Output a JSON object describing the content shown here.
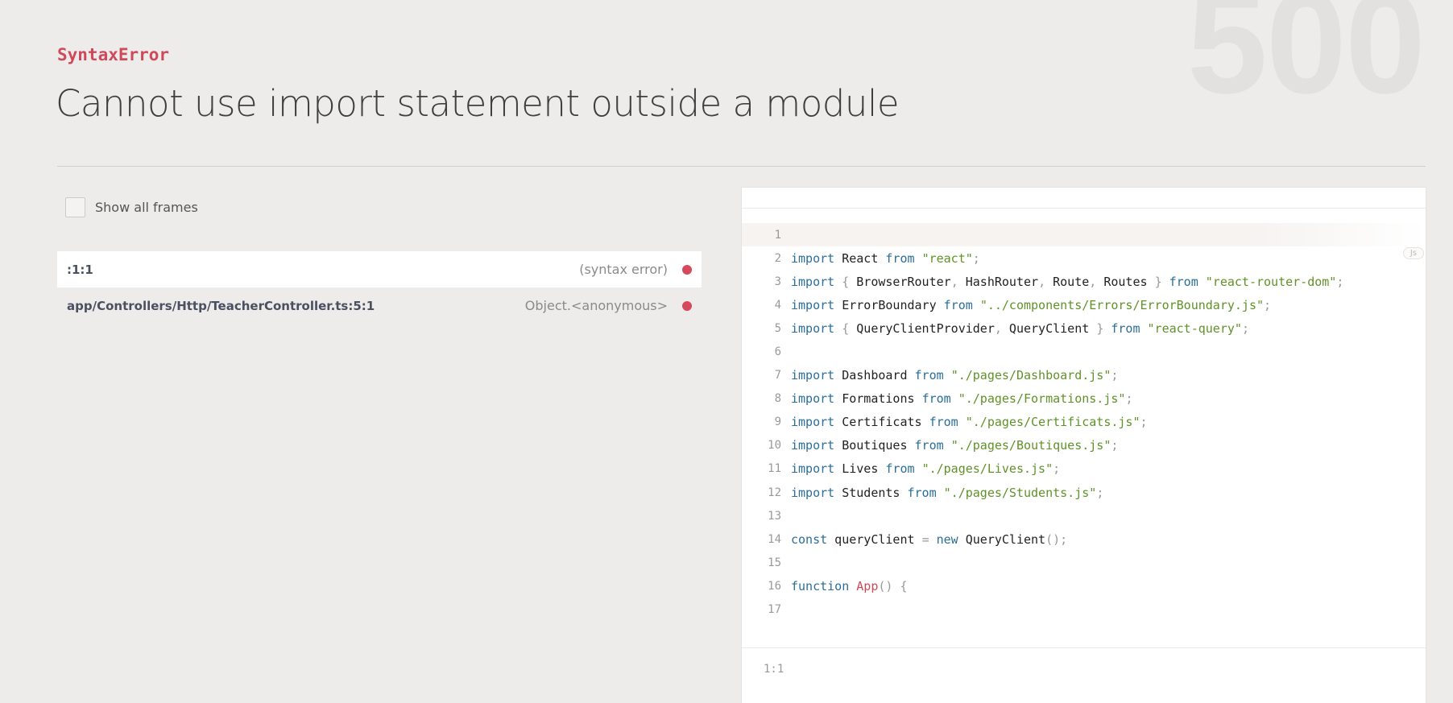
{
  "header": {
    "status_code": "500",
    "error_name": "SyntaxError",
    "error_message": "Cannot use import statement outside a module"
  },
  "frames_toggle": {
    "label": "Show all frames",
    "checked": false
  },
  "frames": [
    {
      "file": ":1:1",
      "method": "(syntax error)",
      "active": true
    },
    {
      "file": "app/Controllers/Http/TeacherController.ts:5:1",
      "method": "Object.<anonymous>",
      "active": false
    }
  ],
  "code_panel": {
    "language_badge": "Js",
    "highlighted_line": 1,
    "footer_position": "1:1",
    "lines": [
      {
        "number": "1",
        "tokens": []
      },
      {
        "number": "2",
        "tokens": [
          [
            "kw",
            "import"
          ],
          [
            "id",
            " React "
          ],
          [
            "kw",
            "from"
          ],
          [
            "id",
            " "
          ],
          [
            "str",
            "\"react\""
          ],
          [
            "pun",
            ";"
          ]
        ]
      },
      {
        "number": "3",
        "tokens": [
          [
            "kw",
            "import"
          ],
          [
            "id",
            " "
          ],
          [
            "pun",
            "{"
          ],
          [
            "id",
            " BrowserRouter"
          ],
          [
            "pun",
            ","
          ],
          [
            "id",
            " HashRouter"
          ],
          [
            "pun",
            ","
          ],
          [
            "id",
            " Route"
          ],
          [
            "pun",
            ","
          ],
          [
            "id",
            " Routes "
          ],
          [
            "pun",
            "}"
          ],
          [
            "id",
            " "
          ],
          [
            "kw",
            "from"
          ],
          [
            "id",
            " "
          ],
          [
            "str",
            "\"react-router-dom\""
          ],
          [
            "pun",
            ";"
          ]
        ]
      },
      {
        "number": "4",
        "tokens": [
          [
            "kw",
            "import"
          ],
          [
            "id",
            " ErrorBoundary "
          ],
          [
            "kw",
            "from"
          ],
          [
            "id",
            " "
          ],
          [
            "str",
            "\"../components/Errors/ErrorBoundary.js\""
          ],
          [
            "pun",
            ";"
          ]
        ]
      },
      {
        "number": "5",
        "tokens": [
          [
            "kw",
            "import"
          ],
          [
            "id",
            " "
          ],
          [
            "pun",
            "{"
          ],
          [
            "id",
            " QueryClientProvider"
          ],
          [
            "pun",
            ","
          ],
          [
            "id",
            " QueryClient "
          ],
          [
            "pun",
            "}"
          ],
          [
            "id",
            " "
          ],
          [
            "kw",
            "from"
          ],
          [
            "id",
            " "
          ],
          [
            "str",
            "\"react-query\""
          ],
          [
            "pun",
            ";"
          ]
        ]
      },
      {
        "number": "6",
        "tokens": []
      },
      {
        "number": "7",
        "tokens": [
          [
            "kw",
            "import"
          ],
          [
            "id",
            " Dashboard "
          ],
          [
            "kw",
            "from"
          ],
          [
            "id",
            " "
          ],
          [
            "str",
            "\"./pages/Dashboard.js\""
          ],
          [
            "pun",
            ";"
          ]
        ]
      },
      {
        "number": "8",
        "tokens": [
          [
            "kw",
            "import"
          ],
          [
            "id",
            " Formations "
          ],
          [
            "kw",
            "from"
          ],
          [
            "id",
            " "
          ],
          [
            "str",
            "\"./pages/Formations.js\""
          ],
          [
            "pun",
            ";"
          ]
        ]
      },
      {
        "number": "9",
        "tokens": [
          [
            "kw",
            "import"
          ],
          [
            "id",
            " Certificats "
          ],
          [
            "kw",
            "from"
          ],
          [
            "id",
            " "
          ],
          [
            "str",
            "\"./pages/Certificats.js\""
          ],
          [
            "pun",
            ";"
          ]
        ]
      },
      {
        "number": "10",
        "tokens": [
          [
            "kw",
            "import"
          ],
          [
            "id",
            " Boutiques "
          ],
          [
            "kw",
            "from"
          ],
          [
            "id",
            " "
          ],
          [
            "str",
            "\"./pages/Boutiques.js\""
          ],
          [
            "pun",
            ";"
          ]
        ]
      },
      {
        "number": "11",
        "tokens": [
          [
            "kw",
            "import"
          ],
          [
            "id",
            " Lives "
          ],
          [
            "kw",
            "from"
          ],
          [
            "id",
            " "
          ],
          [
            "str",
            "\"./pages/Lives.js\""
          ],
          [
            "pun",
            ";"
          ]
        ]
      },
      {
        "number": "12",
        "tokens": [
          [
            "kw",
            "import"
          ],
          [
            "id",
            " Students "
          ],
          [
            "kw",
            "from"
          ],
          [
            "id",
            " "
          ],
          [
            "str",
            "\"./pages/Students.js\""
          ],
          [
            "pun",
            ";"
          ]
        ]
      },
      {
        "number": "13",
        "tokens": []
      },
      {
        "number": "14",
        "tokens": [
          [
            "kw",
            "const"
          ],
          [
            "id",
            " queryClient "
          ],
          [
            "pun",
            "="
          ],
          [
            "id",
            " "
          ],
          [
            "kw",
            "new"
          ],
          [
            "id",
            " QueryClient"
          ],
          [
            "pun",
            "();"
          ]
        ]
      },
      {
        "number": "15",
        "tokens": []
      },
      {
        "number": "16",
        "tokens": [
          [
            "kw",
            "function"
          ],
          [
            "id",
            " "
          ],
          [
            "fn",
            "App"
          ],
          [
            "pun",
            "()"
          ],
          [
            "id",
            " "
          ],
          [
            "pun",
            "{"
          ]
        ]
      },
      {
        "number": "17",
        "tokens": []
      }
    ]
  },
  "colors": {
    "accent_red": "#d0495a",
    "keyword_blue": "#2a6e9a",
    "string_green": "#5f9228",
    "background": "#edecea"
  }
}
